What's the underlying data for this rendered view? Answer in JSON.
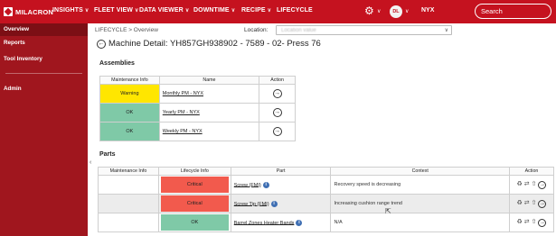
{
  "logo": "MILACRON",
  "nav": [
    {
      "label": "INSIGHTS",
      "chevron": true
    },
    {
      "label": "FLEET VIEW",
      "chevron": true
    },
    {
      "label": "DATA VIEWER",
      "chevron": true
    },
    {
      "label": "DOWNTIME",
      "chevron": true
    },
    {
      "label": "RECIPE",
      "chevron": true
    },
    {
      "label": "LIFECYCLE",
      "chevron": false
    }
  ],
  "user": {
    "initials": "DL",
    "site": "NYX"
  },
  "search": {
    "placeholder": "Search"
  },
  "sidebar": {
    "items": [
      {
        "label": "Overview",
        "active": true
      },
      {
        "label": "Reports",
        "active": false
      },
      {
        "label": "Tool Inventory",
        "active": false
      },
      {
        "label": "Admin",
        "active": false
      }
    ]
  },
  "breadcrumb": "LIFECYCLE > Overview",
  "location": {
    "label": "Location:",
    "value": "Location value"
  },
  "title": "Machine Detail: YH857GH938902 - 7589 - 02- Press 76",
  "assemblies": {
    "heading": "Assemblies",
    "columns": [
      "Maintenance Info",
      "Name",
      "Action"
    ],
    "rows": [
      {
        "status": "Warning",
        "name": "Monthly PM - NYX"
      },
      {
        "status": "OK",
        "name": "Yearly PM - NYX"
      },
      {
        "status": "OK",
        "name": "Weekly PM - NYX"
      }
    ]
  },
  "parts": {
    "heading": "Parts",
    "columns": [
      "Maintenance Info",
      "Lifecycle Info",
      "Part",
      "Context",
      "Action"
    ],
    "rows": [
      {
        "lifecycle": "Critical",
        "part": "Screw (FMI)",
        "context": "Recovery speed is decreasing"
      },
      {
        "lifecycle": "Critical",
        "part": "Screw Tip (FMI)",
        "context": "Increasing cushion range trend"
      },
      {
        "lifecycle": "OK",
        "part": "Barrel Zones Heater Bands",
        "context": "N/A"
      }
    ]
  },
  "colors": {
    "brand": "#c5121f",
    "sidebar": "#a0161e",
    "warning": "#ffe600",
    "ok": "#7fc9a7",
    "critical": "#f25a4d"
  }
}
